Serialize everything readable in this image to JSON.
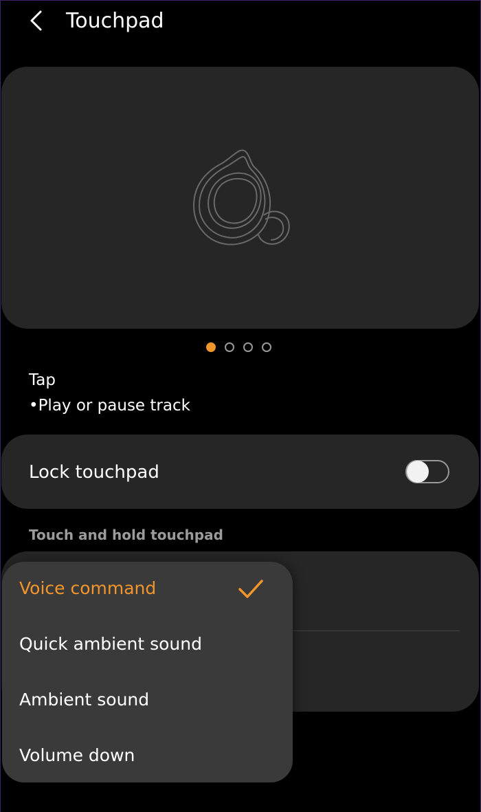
{
  "header": {
    "title": "Touchpad",
    "back_icon": "chevron-left-icon"
  },
  "illustration": {
    "icon": "earbud-icon",
    "pages": 4,
    "active_page": 1
  },
  "gesture": {
    "title": "Tap",
    "description": "•Play or pause track"
  },
  "lock_touchpad": {
    "label": "Lock touchpad",
    "enabled": false
  },
  "touch_hold": {
    "section_label": "Touch and hold touchpad"
  },
  "dropdown": {
    "options": [
      {
        "label": "Voice command",
        "selected": true
      },
      {
        "label": "Quick ambient sound",
        "selected": false
      },
      {
        "label": "Ambient sound",
        "selected": false
      },
      {
        "label": "Volume down",
        "selected": false
      }
    ],
    "check_icon": "check-icon"
  },
  "colors": {
    "accent": "#f2952b",
    "background": "#000000",
    "card": "#262626",
    "popup": "#3a3a3a",
    "muted_text": "#9b9b9b"
  }
}
